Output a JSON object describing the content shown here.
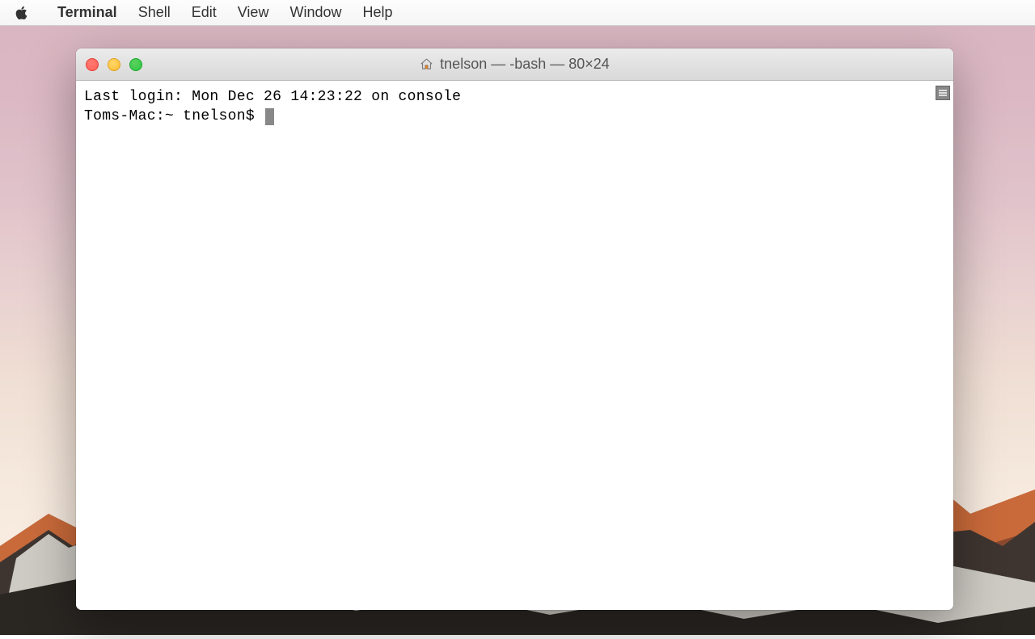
{
  "menubar": {
    "app": "Terminal",
    "items": [
      "Shell",
      "Edit",
      "View",
      "Window",
      "Help"
    ]
  },
  "window": {
    "title": "tnelson — -bash — 80×24"
  },
  "terminal": {
    "lastLogin": "Last login: Mon Dec 26 14:23:22 on console",
    "prompt": "Toms-Mac:~ tnelson$ "
  }
}
